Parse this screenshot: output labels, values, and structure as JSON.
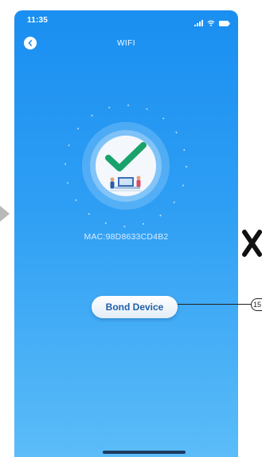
{
  "status_bar": {
    "time": "11:35",
    "icons": [
      "signal-icon",
      "wifi-icon",
      "battery-icon"
    ]
  },
  "nav": {
    "title": "WIFI",
    "back_icon": "back-arrow-icon"
  },
  "main": {
    "success_icon": "checkmark-icon",
    "mac_text": "MAC:98D8633CD4B2",
    "bond_button_label": "Bond Device"
  },
  "annotation": {
    "callout_number": "15"
  },
  "colors": {
    "background_top": "#1a8ff1",
    "background_bottom": "#5bbcf8",
    "checkmark": "#19a36b",
    "button_text": "#1f5fa8"
  }
}
